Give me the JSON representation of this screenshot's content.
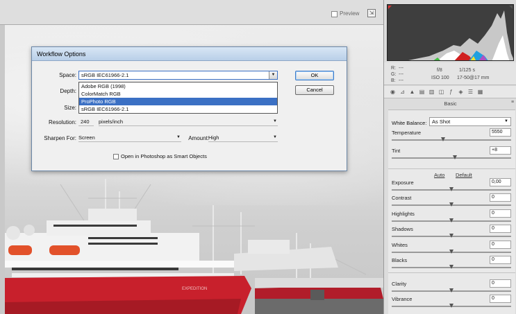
{
  "toolbar": {
    "preview_label": "Preview"
  },
  "dialog": {
    "title": "Workflow Options",
    "space_label": "Space:",
    "space_value": "sRGB IEC61966-2.1",
    "space_options": [
      "Adobe RGB (1998)",
      "ColorMatch RGB",
      "ProPhoto RGB",
      "sRGB IEC61966-2.1"
    ],
    "space_highlighted": "ProPhoto RGB",
    "depth_label": "Depth:",
    "size_label": "Size:",
    "resolution_label": "Resolution:",
    "resolution_value": "240",
    "resolution_unit": "pixels/inch",
    "sharpen_label": "Sharpen For:",
    "sharpen_value": "Screen",
    "amount_label": "Amount:",
    "amount_value": "High",
    "smart_objects_label": "Open in Photoshop as Smart Objects",
    "ok_label": "OK",
    "cancel_label": "Cancel"
  },
  "readout": {
    "r": "R:",
    "r_val": "---",
    "g": "G:",
    "g_val": "---",
    "b": "B:",
    "b_val": "---",
    "aperture": "f/8",
    "shutter": "1/125 s",
    "iso": "ISO 100",
    "lens": "17-50@17 mm"
  },
  "panel": {
    "title": "Basic",
    "white_balance_label": "White Balance:",
    "white_balance_value": "As Shot",
    "auto_label": "Auto",
    "default_label": "Default",
    "sliders": [
      {
        "label": "Temperature",
        "value": "5550",
        "level": 0.43
      },
      {
        "label": "Tint",
        "value": "+8",
        "level": 0.53
      },
      {
        "label": "Exposure",
        "value": "0,00",
        "level": 0.5
      },
      {
        "label": "Contrast",
        "value": "0",
        "level": 0.5
      },
      {
        "label": "Highlights",
        "value": "0",
        "level": 0.5
      },
      {
        "label": "Shadows",
        "value": "0",
        "level": 0.5
      },
      {
        "label": "Whites",
        "value": "0",
        "level": 0.5
      },
      {
        "label": "Blacks",
        "value": "0",
        "level": 0.5
      },
      {
        "label": "Clarity",
        "value": "0",
        "level": 0.5
      },
      {
        "label": "Vibrance",
        "value": "0",
        "level": 0.5
      }
    ]
  },
  "photo": {
    "ship_name": "EXPEDITION"
  },
  "colors": {
    "hull_red": "#c8202c",
    "selection_blue": "#3b70c4",
    "histogram_bg": "#3e3e3e"
  }
}
